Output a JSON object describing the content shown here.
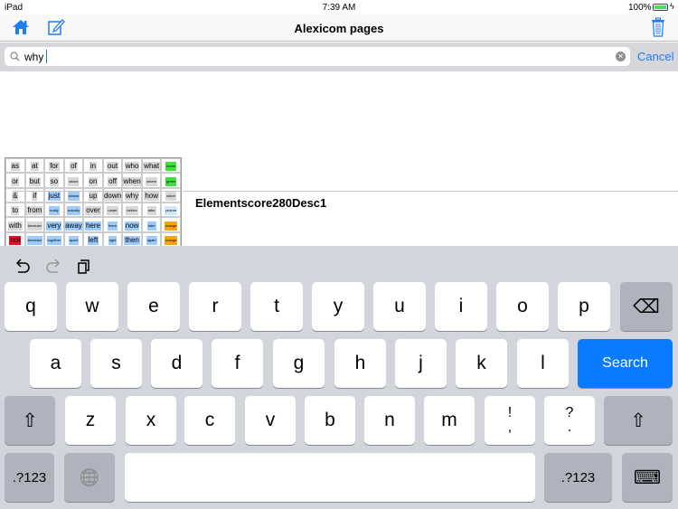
{
  "status": {
    "device": "iPad",
    "time": "7:39 AM",
    "battery": "100%"
  },
  "nav": {
    "title": "Alexicom pages",
    "left_icons": [
      "home-icon",
      "compose-icon"
    ],
    "right_icon": "trash-icon",
    "accent": "#1f7cf5"
  },
  "search": {
    "value": "why",
    "cancel": "Cancel"
  },
  "results": [
    {
      "title": "Elementscore280Desc1",
      "grid": [
        [
          "as",
          "at",
          "for",
          "of",
          "in",
          "out",
          "who",
          "what",
          "home"
        ],
        [
          "or",
          "but",
          "so",
          "about",
          "on",
          "off",
          "when",
          "where",
          "green"
        ],
        [
          "&",
          "if",
          "just",
          "almost",
          "up",
          "down",
          "why",
          "how",
          "which"
        ],
        [
          "to",
          "from",
          "really",
          "actually",
          "over",
          "under",
          "before",
          "after",
          "picture"
        ],
        [
          "with",
          "because",
          "very",
          "away",
          "here",
          "there",
          "now",
          "later",
          "orange"
        ],
        [
          "not",
          "because",
          "together",
          "apart",
          "left",
          "right",
          "then",
          "again",
          "orange"
        ]
      ],
      "colors": [
        [
          "g",
          "g",
          "g",
          "g",
          "g",
          "g",
          "g",
          "g",
          "G"
        ],
        [
          "g",
          "g",
          "g",
          "g",
          "g",
          "g",
          "g",
          "g",
          "G"
        ],
        [
          "g",
          "g",
          "b",
          "b",
          "g",
          "g",
          "g",
          "g",
          "g"
        ],
        [
          "g",
          "g",
          "b",
          "b",
          "g",
          "g",
          "g",
          "g",
          "L"
        ],
        [
          "g",
          "g",
          "b",
          "b",
          "b",
          "b",
          "b",
          "b",
          "O"
        ],
        [
          "R",
          "b",
          "b",
          "b",
          "b",
          "b",
          "b",
          "b",
          "O"
        ]
      ]
    }
  ],
  "keyboard": {
    "toolbar": [
      "undo-icon",
      "redo-icon",
      "paste-icon"
    ],
    "rows": [
      [
        "q",
        "w",
        "e",
        "r",
        "t",
        "y",
        "u",
        "i",
        "o",
        "p",
        "⌫"
      ],
      [
        "a",
        "s",
        "d",
        "f",
        "g",
        "h",
        "j",
        "k",
        "l",
        "Search"
      ],
      [
        "⇧",
        "z",
        "x",
        "c",
        "v",
        "b",
        "n",
        "m",
        "!\n,",
        "?\n.",
        "⇧"
      ],
      [
        ".?123",
        "🌐",
        "",
        ".?123",
        "⌨"
      ]
    ]
  }
}
